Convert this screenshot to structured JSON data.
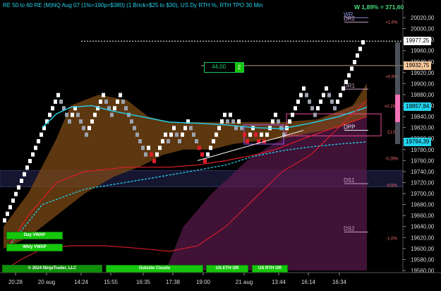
{
  "header": {
    "title": "RE 50 to 60 RE (M)NQ Aug 07 (1%=190p=$380) (1 Brick=$25 to $30), US Dy RTH %, RTH TPO 30 Min",
    "w_stat": "W 1,89% = 371,60"
  },
  "price_box": {
    "value": "44,00",
    "count": "2"
  },
  "y_axis": {
    "ticks": [
      "20020,00",
      "20000,00",
      "19980,00",
      "19960,00",
      "19940,00",
      "19920,00",
      "19900,00",
      "19880,00",
      "19860,00",
      "19840,00",
      "19820,00",
      "19800,00",
      "19780,00",
      "19760,00",
      "19740,00",
      "19720,00",
      "19700,00",
      "19680,00",
      "19660,00",
      "19640,00",
      "19620,00",
      "19600,00",
      "19580,00",
      "19560,00"
    ],
    "ylim": [
      19560,
      20020
    ]
  },
  "price_tags": [
    {
      "label": "19977,25",
      "price": 19977.25,
      "bg": "#ffffff",
      "fg": "#000000"
    },
    {
      "label": "19932,75",
      "price": 19932.75,
      "bg": "#f5c89a",
      "fg": "#000000"
    },
    {
      "label": "19857,84",
      "price": 19857.84,
      "bg": "#22d3ee",
      "fg": "#000000"
    },
    {
      "label": "19794,39",
      "price": 19794.39,
      "bg": "#22d3ee",
      "fg": "#000000"
    }
  ],
  "x_axis": {
    "ticks": [
      "20:28",
      "20 aug",
      "14:24",
      "15:55",
      "16:35",
      "17:38",
      "19:00",
      "21 aug",
      "13:44",
      "16:14",
      "16:34"
    ]
  },
  "levels": [
    {
      "name": "WR",
      "price": 20020
    },
    {
      "name": "DR2",
      "price": 20012
    },
    {
      "name": "DR1",
      "price": 19890
    },
    {
      "name": "DPP",
      "price": 19815
    },
    {
      "name": "DS1",
      "price": 19718
    },
    {
      "name": "DS2",
      "price": 19630
    }
  ],
  "pct_labels": [
    {
      "label": "+1.0%",
      "price": 20013
    },
    {
      "label": "+0.5%",
      "price": 19914
    },
    {
      "label": "+0.25%",
      "price": 19860
    },
    {
      "label": "CLS",
      "price": 19813
    },
    {
      "label": "-0.25%",
      "price": 19765
    },
    {
      "label": "-0.5%",
      "price": 19716
    },
    {
      "label": "-1.0%",
      "price": 19620
    }
  ],
  "buttons": {
    "day_vwap": "Day VWAP",
    "wkly_vwap": "Wkly VWAP",
    "bottom_bar": "© 2024 NinjaTrader, LLC",
    "outside_clouds": "Outside Clouds",
    "us_eth_or": "US ETH OR",
    "us_rth_or": "US RTH OR"
  },
  "colors": {
    "up_brick": "#ffffff",
    "down_brick": "#e11d2a",
    "neutral_brick": "#9ca3af",
    "cloud": "#7c4a16",
    "vwap": "#22d3ee",
    "dashed": "#22d3ee",
    "red_line": "#e11d2a",
    "magenta_cloud": "#5b1a4d",
    "accent_green": "#16c60c"
  }
}
